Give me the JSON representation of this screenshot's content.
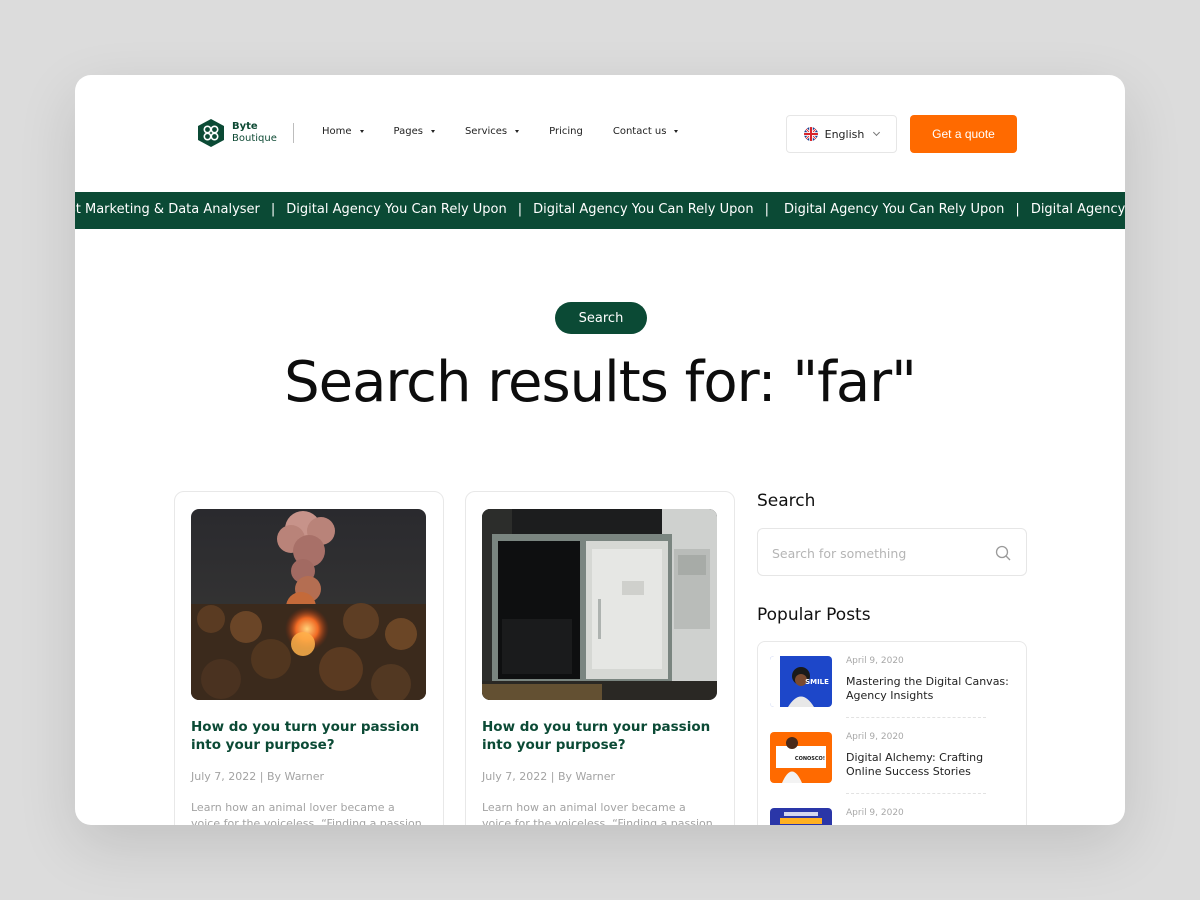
{
  "brand": {
    "name_line1": "Byte",
    "name_line2": "Boutique"
  },
  "nav": [
    {
      "label": "Home",
      "dropdown": true
    },
    {
      "label": "Pages",
      "dropdown": true
    },
    {
      "label": "Services",
      "dropdown": true
    },
    {
      "label": "Pricing",
      "dropdown": false
    },
    {
      "label": "Contact us",
      "dropdown": true
    }
  ],
  "language": {
    "label": "English",
    "icon": "uk-flag-icon"
  },
  "cta": {
    "label": "Get a quote"
  },
  "ticker": [
    "est Marketing & Data Analyser",
    "Digital Agency You Can Rely Upon",
    "Digital Agency You Can Rely Upon",
    "Digital Agency You Can Rely Upon",
    "Digital Agency You Can Re"
  ],
  "ticker_separator": "|",
  "hero": {
    "badge": "Search",
    "title": "Search results for: \"far\""
  },
  "results": [
    {
      "title": "How do you turn your passion into your purpose?",
      "meta": "July 7, 2022 | By Warner",
      "excerpt": "Learn how an animal lover became a voice for the voiceless. “Finding a passion is"
    },
    {
      "title": "How do you turn your passion into your purpose?",
      "meta": "July 7, 2022 | By Warner",
      "excerpt": "Learn how an animal lover became a voice for the voiceless. “Finding a passion is"
    }
  ],
  "sidebar": {
    "search_heading": "Search",
    "search_placeholder": "Search for something",
    "popular_heading": "Popular Posts",
    "posts": [
      {
        "date": "April 9, 2020",
        "title": "Mastering the Digital Canvas: Agency Insights",
        "thumb_text": "SMILE"
      },
      {
        "date": "April 9, 2020",
        "title": "Digital Alchemy: Crafting Online Success Stories",
        "thumb_text": "CONOSCO!"
      },
      {
        "date": "April 9, 2020",
        "title": "",
        "thumb_text": ""
      }
    ]
  },
  "colors": {
    "brand_green": "#0b4a35",
    "accent_orange": "#ff6a00"
  }
}
